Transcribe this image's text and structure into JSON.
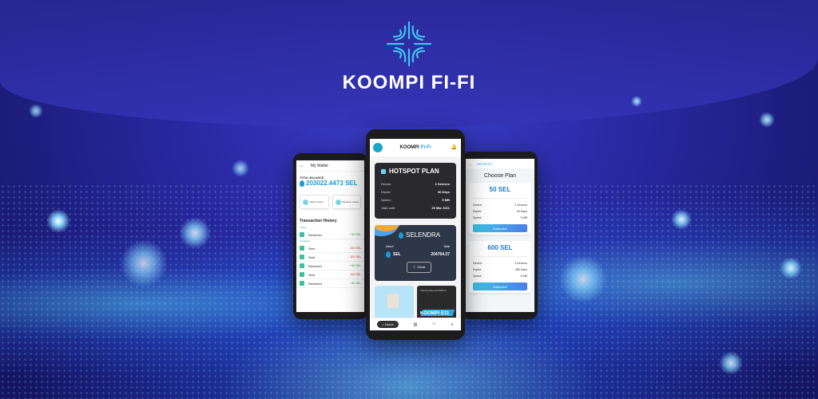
{
  "brand": {
    "title": "KOOMPI FI-FI"
  },
  "wallet": {
    "header": "My Wallet",
    "balance_label": "TOTAL BALANCE",
    "balance_value": "203022.4473 SEL",
    "actions": [
      "Send money",
      "Receive money"
    ],
    "history_title": "Transaction History",
    "today_label": "Today",
    "yesterday_label": "Yesterday",
    "transactions": [
      {
        "name": "Recieved",
        "amount": "+ 50 SEL",
        "type": "pos"
      },
      {
        "name": "Sent",
        "amount": "- 100 SEL",
        "type": "neg"
      },
      {
        "name": "Sent",
        "amount": "- 100 SEL",
        "type": "neg"
      },
      {
        "name": "Recieved",
        "amount": "+ 50 SEL",
        "type": "pos"
      },
      {
        "name": "Sent",
        "amount": "- 100 SEL",
        "type": "neg"
      },
      {
        "name": "Recieved",
        "amount": "+ 50 SEL",
        "type": "pos"
      }
    ]
  },
  "home": {
    "header_brand": "KOOMPI",
    "header_suffix": "Fi-Fi",
    "hotspot": {
      "title": "HOTSPOT PLAN",
      "rows": [
        {
          "k": "Device:",
          "v": "2 Devices"
        },
        {
          "k": "Expire:",
          "v": "30 Days"
        },
        {
          "k": "Speed:",
          "v": "5 MB"
        },
        {
          "k": "Valid until:",
          "v": "29 Mar 2021"
        }
      ]
    },
    "token": {
      "name": "SELENDRA",
      "asset_label": "Asset",
      "total_label": "Total",
      "symbol": "SEL",
      "amount": "204764.37",
      "detail_label": "Detail"
    },
    "ad_text": "Thumb drive and SSD is",
    "ad_big": "KOOMPI E11",
    "nav": {
      "home": "Home"
    }
  },
  "plans": {
    "header_brand": "HOTSPOT",
    "title": "Choose Plan",
    "items": [
      {
        "price": "50 SEL",
        "rows": [
          {
            "k": "Device:",
            "v": "2 Devices"
          },
          {
            "k": "Expire:",
            "v": "30 Days"
          },
          {
            "k": "Speed:",
            "v": "5 MB"
          }
        ],
        "button": "Subscribe"
      },
      {
        "price": "600 SEL",
        "rows": [
          {
            "k": "Device:",
            "v": "2 Devices"
          },
          {
            "k": "Expire:",
            "v": "365 Days"
          },
          {
            "k": "Speed:",
            "v": "5 MB"
          }
        ],
        "button": "Subscribe"
      }
    ]
  },
  "colors": {
    "accent": "#1aa2d8",
    "positive": "#2ea44f",
    "negative": "#d93a3a",
    "background": "#2a2aa6"
  }
}
